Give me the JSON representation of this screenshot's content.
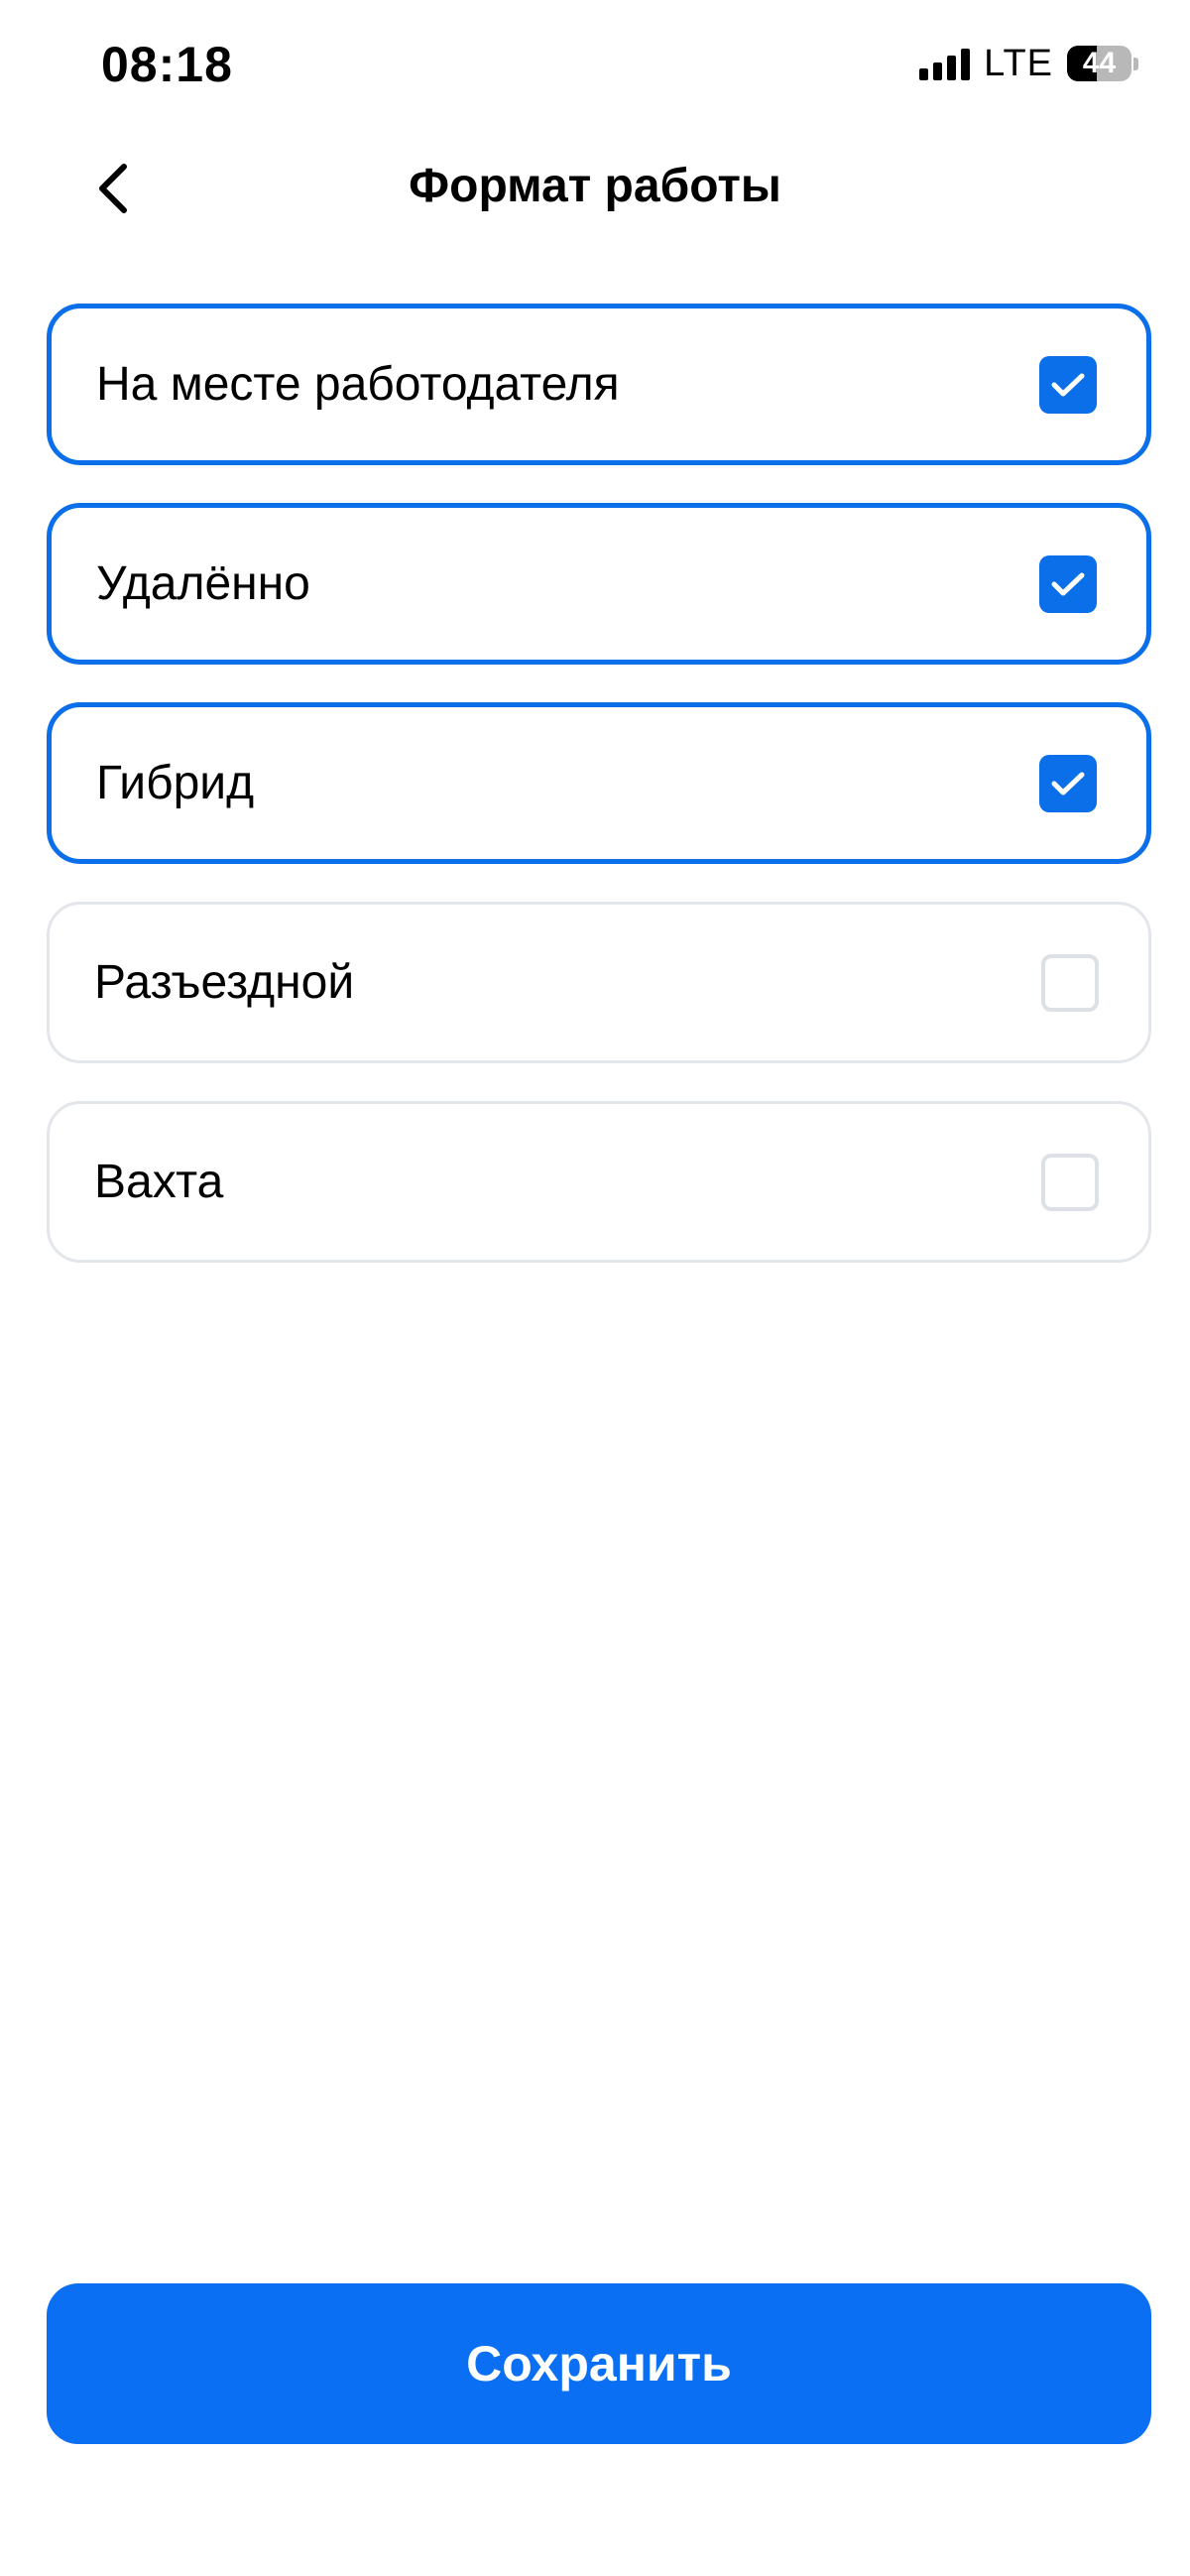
{
  "status_bar": {
    "time": "08:18",
    "network": "LTE",
    "battery": "44",
    "signal_icon": "signal-bars-icon",
    "battery_icon": "battery-icon"
  },
  "header": {
    "title": "Формат работы",
    "back_icon": "chevron-left-icon"
  },
  "options": [
    {
      "label": "На месте работодателя",
      "checked": true
    },
    {
      "label": "Удалённо",
      "checked": true
    },
    {
      "label": "Гибрид",
      "checked": true
    },
    {
      "label": "Разъездной",
      "checked": false
    },
    {
      "label": "Вахта",
      "checked": false
    }
  ],
  "save_button": {
    "label": "Сохранить"
  },
  "colors": {
    "accent": "#0a6fe8",
    "button": "#0a6ff2",
    "unchecked_border": "#e3e6ea"
  }
}
